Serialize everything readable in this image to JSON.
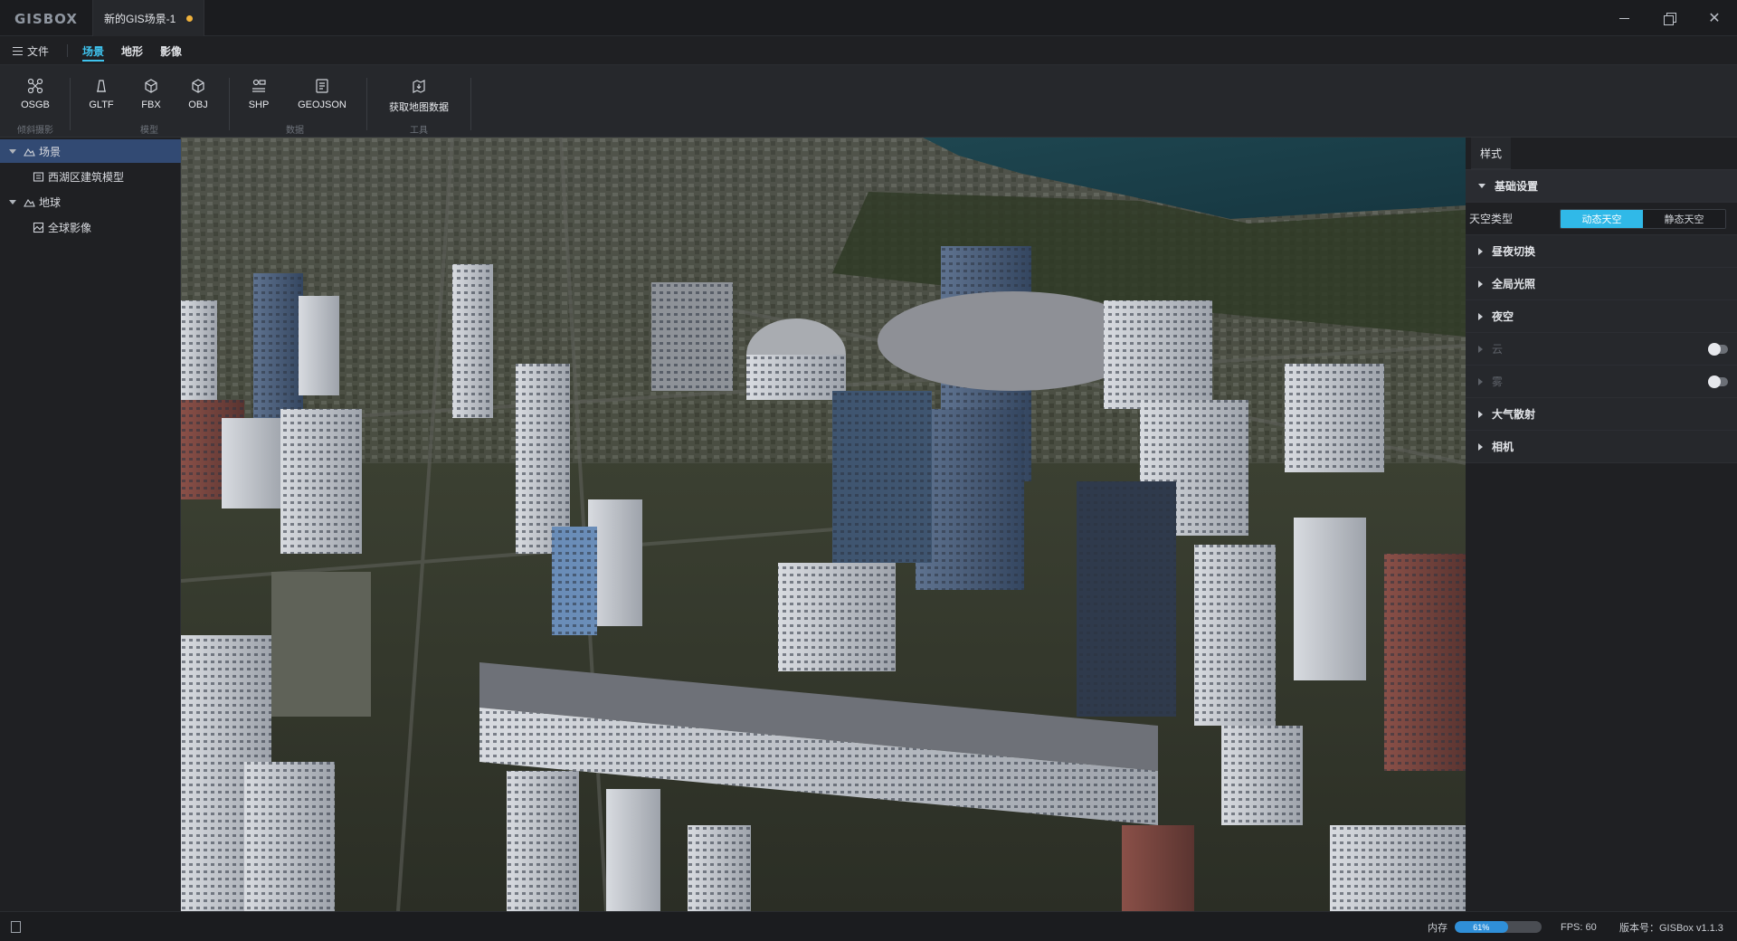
{
  "titlebar": {
    "logo": "GISBOX",
    "document_tab": "新的GIS场景-1",
    "unsaved_dot_color": "#f0b23c"
  },
  "menu": {
    "file": "文件",
    "tabs": [
      "场景",
      "地形",
      "影像"
    ],
    "active_tab": "场景"
  },
  "toolbar": {
    "groups": [
      {
        "label": "倾斜摄影",
        "tools": [
          "OSGB"
        ]
      },
      {
        "label": "模型",
        "tools": [
          "GLTF",
          "FBX",
          "OBJ"
        ]
      },
      {
        "label": "数据",
        "tools": [
          "SHP",
          "GEOJSON"
        ]
      },
      {
        "label": "工具",
        "tools": [
          "获取地图数据"
        ]
      }
    ]
  },
  "tree": {
    "items": [
      {
        "label": "场景",
        "level": 0,
        "expanded": true,
        "selected": true
      },
      {
        "label": "西湖区建筑模型",
        "level": 1
      },
      {
        "label": "地球",
        "level": 0,
        "expanded": true
      },
      {
        "label": "全球影像",
        "level": 1
      }
    ]
  },
  "rightpanel": {
    "tab": "样式",
    "sections": {
      "basic": "基础设置",
      "sky_type_label": "天空类型",
      "sky_options": [
        "动态天空",
        "静态天空"
      ],
      "sky_selected": "动态天空",
      "day_night": "昼夜切换",
      "global_light": "全局光照",
      "night_sky": "夜空",
      "cloud": "云",
      "fog": "雾",
      "atmosphere": "大气散射",
      "camera": "相机"
    },
    "accent_color": "#30b9e8"
  },
  "statusbar": {
    "memory_label": "内存",
    "memory_percent_text": "61%",
    "memory_percent": 61,
    "fps": "FPS: 60",
    "version": "版本号：GISBox v1.1.3"
  }
}
